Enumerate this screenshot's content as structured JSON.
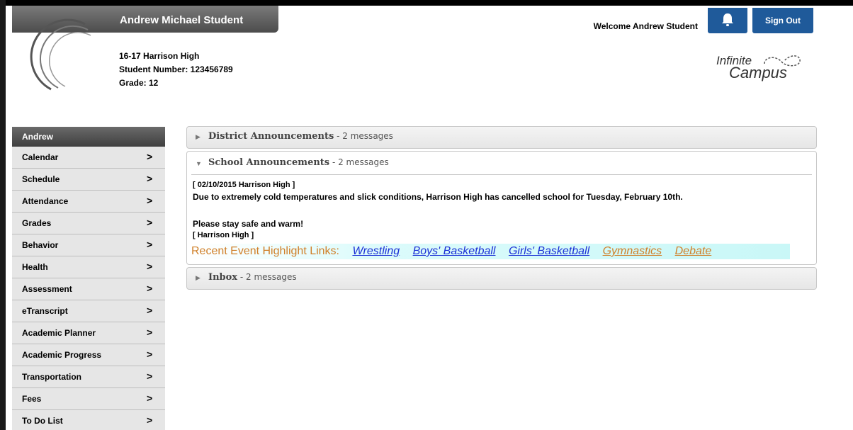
{
  "student": {
    "name": "Andrew Michael Student",
    "school": "16-17 Harrison High",
    "student_number": "Student Number: 123456789",
    "grade": "Grade: 12"
  },
  "header": {
    "welcome": "Welcome Andrew Student",
    "sign_out": "Sign Out",
    "logo_line1": "Infinite",
    "logo_line2": "Campus"
  },
  "sidebar": {
    "title": "Andrew",
    "items": [
      {
        "label": "Calendar"
      },
      {
        "label": "Schedule"
      },
      {
        "label": "Attendance"
      },
      {
        "label": "Grades"
      },
      {
        "label": "Behavior"
      },
      {
        "label": "Health"
      },
      {
        "label": "Assessment"
      },
      {
        "label": "eTranscript"
      },
      {
        "label": "Academic Planner"
      },
      {
        "label": "Academic Progress"
      },
      {
        "label": "Transportation"
      },
      {
        "label": "Fees"
      },
      {
        "label": "To Do List"
      }
    ],
    "chevron": ">"
  },
  "panels": {
    "district": {
      "title": "District Announcements",
      "count": " - 2 messages"
    },
    "school": {
      "title": "School Announcements",
      "count": " - 2 messages",
      "message_header": "[ 02/10/2015 Harrison High ]",
      "message_body": "Due to extremely cold temperatures and slick conditions, Harrison High has cancelled school for Tuesday, February 10th.",
      "message_closing": "Please stay safe and warm!",
      "message_footer": "[ Harrison High ]",
      "links_lead": "Recent Event Highlight Links:",
      "links": [
        "Wrestling",
        "Boys' Basketball",
        "Girls' Basketball",
        "Gymnastics",
        "Debate"
      ]
    },
    "inbox": {
      "title": "Inbox",
      "count": " - 2 messages"
    }
  },
  "colors": {
    "accent_blue": "#1f5a9a",
    "link_blue": "#1a2fd6",
    "link_orange": "#d0802a"
  }
}
